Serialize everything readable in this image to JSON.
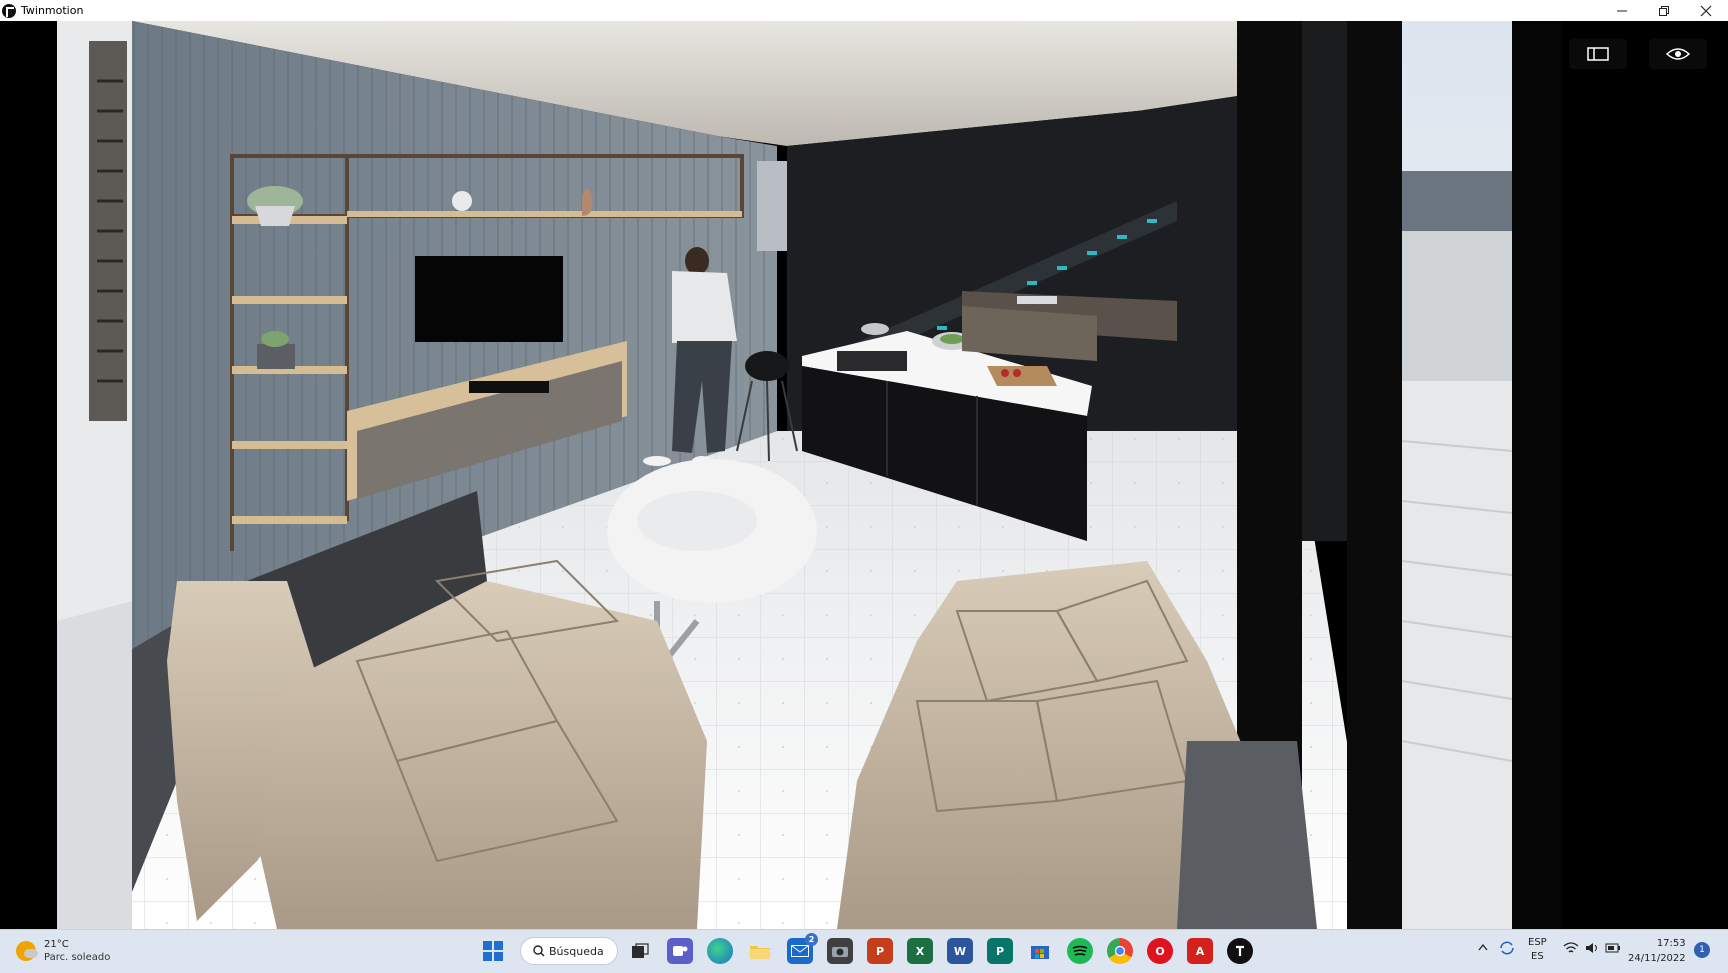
{
  "window": {
    "title": "Twinmotion"
  },
  "viewport": {
    "buttons": [
      {
        "name": "panel-toggle",
        "icon": "panel-icon"
      },
      {
        "name": "view-toggle",
        "icon": "eye-icon"
      }
    ]
  },
  "taskbar": {
    "weather": {
      "temp": "21°C",
      "desc": "Parc. soleado"
    },
    "search_label": "Búsqueda",
    "apps": [
      {
        "name": "start",
        "icon": "windows-icon"
      },
      {
        "name": "task-view",
        "icon": "task-view-icon"
      },
      {
        "name": "teams",
        "icon": "teams-icon"
      },
      {
        "name": "edge",
        "icon": "edge-icon"
      },
      {
        "name": "file-explorer",
        "icon": "folder-icon"
      },
      {
        "name": "mail",
        "icon": "mail-icon",
        "badge": "2"
      },
      {
        "name": "camera",
        "icon": "camera-icon"
      },
      {
        "name": "powerpoint",
        "icon": "powerpoint-icon",
        "letter": "P"
      },
      {
        "name": "excel",
        "icon": "excel-icon",
        "letter": "X"
      },
      {
        "name": "word",
        "icon": "word-icon",
        "letter": "W"
      },
      {
        "name": "publisher",
        "icon": "publisher-icon",
        "letter": "P"
      },
      {
        "name": "store",
        "icon": "store-icon"
      },
      {
        "name": "spotify",
        "icon": "spotify-icon"
      },
      {
        "name": "chrome",
        "icon": "chrome-icon"
      },
      {
        "name": "opera",
        "icon": "opera-icon",
        "letter": "O"
      },
      {
        "name": "acrobat",
        "icon": "acrobat-icon",
        "letter": "A"
      },
      {
        "name": "twinmotion",
        "icon": "twinmotion-icon"
      }
    ],
    "tray": {
      "lang_top": "ESP",
      "lang_bottom": "ES"
    },
    "clock": {
      "time": "17:53",
      "date": "24/11/2022"
    },
    "notifications": "1"
  }
}
